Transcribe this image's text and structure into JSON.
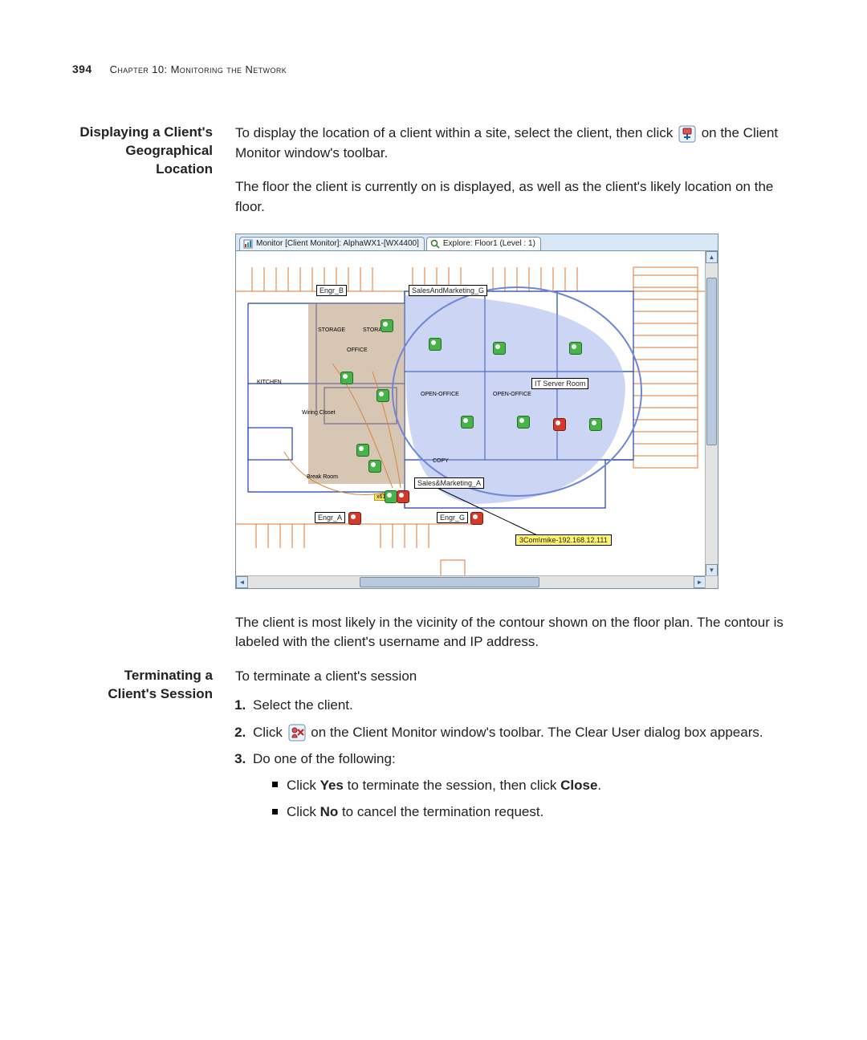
{
  "page": {
    "number": "394",
    "chapter_label": "Chapter 10: Monitoring the Network"
  },
  "section1": {
    "heading": "Displaying a Client's Geographical Location",
    "para1_before_icon": "To display the location of a client within a site, select the client, then click ",
    "para1_after_icon": " on the Client Monitor window's toolbar.",
    "para2": "The floor the client is currently on is displayed, as well as the client's likely location on the floor.",
    "para3": "The client is most likely in the vicinity of the contour shown on the floor plan. The contour is labeled with the client's username and IP address."
  },
  "figure": {
    "tabs": [
      {
        "icon": "monitor-icon",
        "label": "Monitor [Client Monitor]: AlphaWX1-[WX4400]",
        "active": false
      },
      {
        "icon": "explore-icon",
        "label": "Explore: Floor1 (Level : 1)",
        "active": true
      }
    ],
    "room_labels": {
      "engr_b": {
        "text": "Engr_B"
      },
      "sales_g": {
        "text": "SalesAndMarketing_G"
      },
      "it_room": {
        "text": "IT Server Room"
      },
      "sales_a": {
        "text": "Sales&Marketing_A"
      },
      "engr_a": {
        "text": "Engr_A"
      },
      "engr_g": {
        "text": "Engr_G"
      }
    },
    "tiny_labels": {
      "storage1": "STORAGE",
      "storage2": "STORAGE",
      "office": "OFFICE",
      "open1": "OPEN-OFFICE",
      "open2": "OPEN-OFFICE",
      "copy": "COPY",
      "break": "Break Room",
      "kitchen": "KITCHEN",
      "wiring": "Wiring Closet",
      "x611": "x611"
    },
    "client_tag": "3Com\\mike-192.168.12.111"
  },
  "section2": {
    "heading": "Terminating a Client's Session",
    "intro": "To terminate a client's session",
    "steps": {
      "s1": "Select the client.",
      "s2_before_icon": "Click ",
      "s2_after_icon": " on the Client Monitor window's toolbar. The Clear User dialog box appears.",
      "s3": "Do one of the following:",
      "sub": {
        "a_pre": "Click ",
        "a_bold": "Yes",
        "a_mid": " to terminate the session, then click ",
        "a_bold2": "Close",
        "a_post": ".",
        "b_pre": "Click ",
        "b_bold": "No",
        "b_post": " to cancel the termination request."
      }
    }
  }
}
